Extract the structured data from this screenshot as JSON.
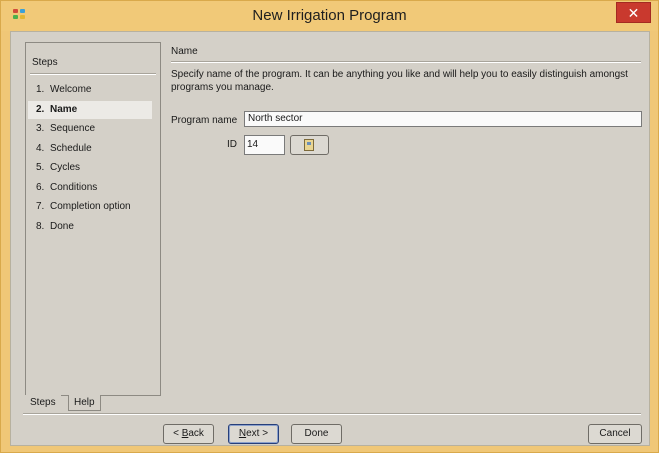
{
  "window": {
    "title": "New Irrigation Program",
    "close_label": "✕"
  },
  "steps": {
    "heading": "Steps",
    "items": [
      {
        "num": "1.",
        "label": "Welcome"
      },
      {
        "num": "2.",
        "label": "Name",
        "active": true
      },
      {
        "num": "3.",
        "label": "Sequence"
      },
      {
        "num": "4.",
        "label": "Schedule"
      },
      {
        "num": "5.",
        "label": "Cycles"
      },
      {
        "num": "6.",
        "label": "Conditions"
      },
      {
        "num": "7.",
        "label": "Completion option"
      },
      {
        "num": "8.",
        "label": "Done"
      }
    ],
    "tabs": [
      "Steps",
      "Help"
    ]
  },
  "content": {
    "section_title": "Name",
    "description": "Specify name of the program. It can be anything you like and will help you to easily distinguish amongst programs you manage.",
    "name_label": "Program name",
    "name_value": "North sector",
    "id_label": "ID",
    "id_value": "14"
  },
  "buttons": {
    "back": {
      "prefix": "< ",
      "mnemonic": "B",
      "rest": "ack"
    },
    "next": {
      "mnemonic": "N",
      "rest": "ext >"
    },
    "done": "Done",
    "cancel": "Cancel"
  },
  "colors": {
    "title_bar": "#f1c978",
    "client_bg": "#d4d0c8",
    "close_button": "#c9392e"
  }
}
